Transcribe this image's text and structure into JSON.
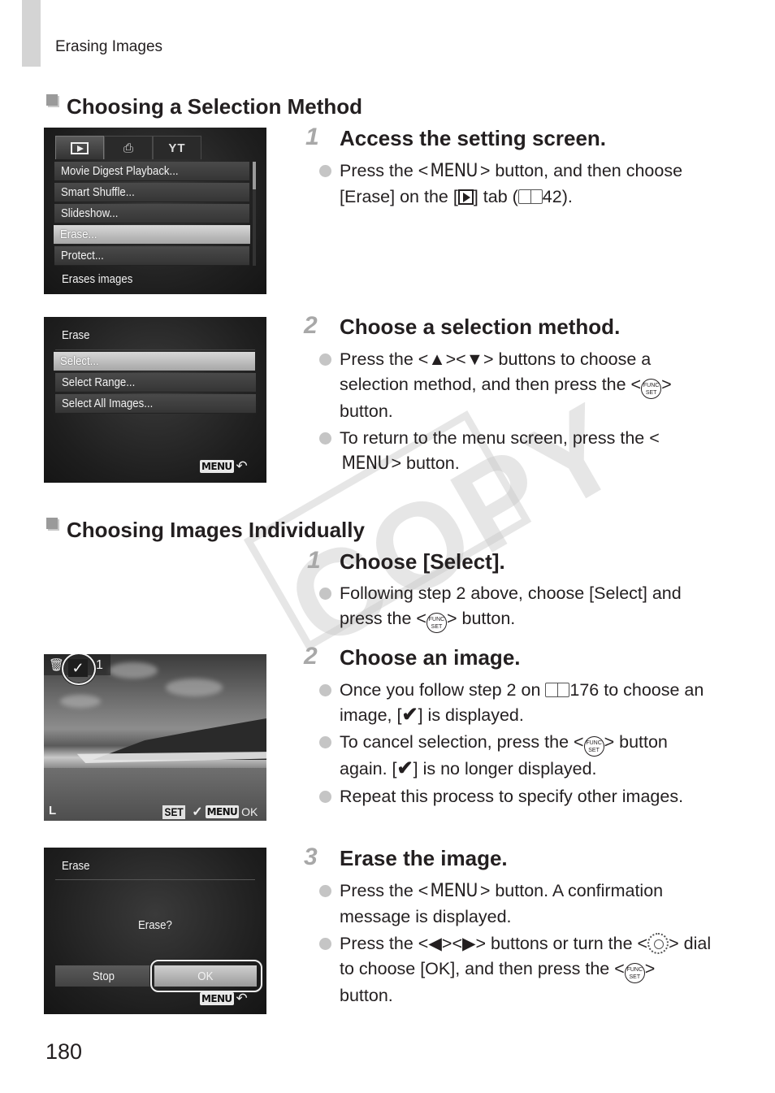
{
  "page": {
    "running_head": "Erasing Images",
    "page_number": "180",
    "watermark": "COPY"
  },
  "sections": [
    {
      "title": "Choosing a Selection Method",
      "steps": [
        {
          "number": "1",
          "title": "Access the setting screen.",
          "bullets": [
            {
              "parts": [
                "Press the <",
                "MENU",
                "> button, and then choose [Erase] on the [",
                "▶",
                "] tab (",
                "book",
                "42)."
              ]
            }
          ]
        },
        {
          "number": "2",
          "title": "Choose a selection method.",
          "bullets": [
            {
              "text_a": "Press the <▲><▼> buttons to choose a selection method, and then press the <",
              "icon": "FUNC. SET",
              "text_b": "> button."
            },
            {
              "text_a": "To return to the menu screen, press the <",
              "menu": "MENU",
              "text_b": "> button."
            }
          ]
        }
      ]
    },
    {
      "title": "Choosing Images Individually",
      "steps": [
        {
          "number": "1",
          "title": "Choose [Select].",
          "bullets": [
            {
              "text_a": "Following step 2 above, choose [Select] and press the <",
              "icon": "FUNC. SET",
              "text_b": "> button."
            }
          ]
        },
        {
          "number": "2",
          "title": "Choose an image.",
          "bullets": [
            {
              "text_a": "Once you follow step 2 on ",
              "ref": "176",
              "text_b": " to choose an image, [",
              "check": "✔",
              "text_c": "] is displayed."
            },
            {
              "text_a": "To cancel selection, press the <",
              "icon": "FUNC. SET",
              "text_b": "> button again. [",
              "check": "✔",
              "text_c": "] is no longer displayed."
            },
            {
              "text_a": "Repeat this process to specify other images."
            }
          ]
        },
        {
          "number": "3",
          "title": "Erase the image.",
          "bullets": [
            {
              "text_a": "Press the <",
              "menu": "MENU",
              "text_b": "> button. A confirmation message is displayed."
            },
            {
              "text_a": "Press the <◀><▶> buttons or turn the <",
              "dial": "dial",
              "text_b": "> dial to choose [OK], and then press the <",
              "icon": "FUNC. SET",
              "text_c": "> button."
            }
          ]
        }
      ]
    }
  ],
  "screens": {
    "playback_menu": {
      "tabs": [
        {
          "icon": "play-icon",
          "glyph": "▶",
          "active": true
        },
        {
          "icon": "print-icon",
          "glyph": "⎙",
          "active": false
        },
        {
          "icon": "settings-icon",
          "glyph": "YT",
          "active": false
        }
      ],
      "items": [
        "Movie Digest Playback...",
        "Smart Shuffle...",
        "Slideshow...",
        "Erase...",
        "Protect..."
      ],
      "selected_index": 3,
      "hint": "Erases images"
    },
    "erase_menu": {
      "title": "Erase",
      "items": [
        "Select...",
        "Select Range...",
        "Select All Images..."
      ],
      "selected_index": 0,
      "menu_badge": "MENU",
      "return_glyph": "↶"
    },
    "select_image": {
      "trash_glyph": "🗑",
      "check_glyph": "✓",
      "count": "1",
      "size_label": "L",
      "set_badge": "SET",
      "set_action": "✓",
      "menu_badge": "MENU",
      "menu_action": "OK"
    },
    "erase_confirm": {
      "title": "Erase",
      "question": "Erase?",
      "buttons": [
        "Stop",
        "OK"
      ],
      "selected_button": "OK",
      "menu_badge": "MENU",
      "return_glyph": "↶"
    }
  }
}
